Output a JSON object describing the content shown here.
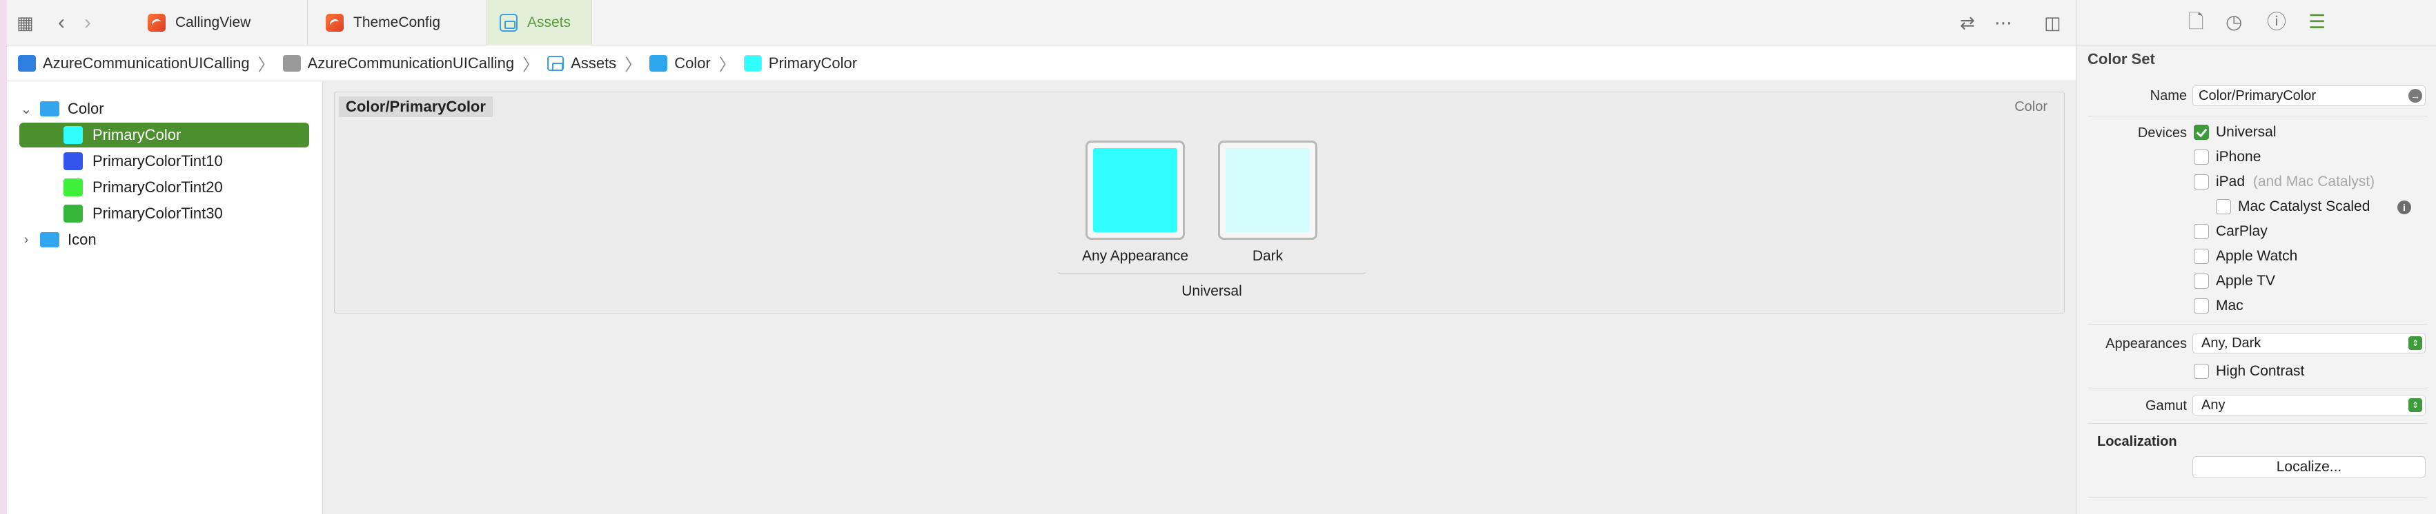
{
  "tabs": [
    {
      "label": "CallingView",
      "icon": "swift-file-icon"
    },
    {
      "label": "ThemeConfig",
      "icon": "swift-file-icon"
    },
    {
      "label": "Assets",
      "icon": "asset-catalog-icon",
      "active": true
    }
  ],
  "breadcrumb": [
    "AzureCommunicationUICalling",
    "AzureCommunicationUICalling",
    "Assets",
    "Color",
    "PrimaryColor"
  ],
  "navigator": {
    "folders": [
      {
        "label": "Color",
        "expanded": true
      },
      {
        "label": "Icon",
        "expanded": false
      }
    ],
    "items": [
      {
        "label": "PrimaryColor",
        "color": "#2fffff",
        "selected": true
      },
      {
        "label": "PrimaryColorTint10",
        "color": "#3355ee"
      },
      {
        "label": "PrimaryColorTint20",
        "color": "#3ef03a"
      },
      {
        "label": "PrimaryColorTint30",
        "color": "#36b53a"
      }
    ]
  },
  "colorset": {
    "title": "Color/PrimaryColor",
    "type": "Color",
    "wells": [
      {
        "label": "Any Appearance",
        "color": "#2fffff"
      },
      {
        "label": "Dark",
        "color": "#d3fcfc"
      }
    ],
    "group_label": "Universal"
  },
  "inspector": {
    "section_title": "Color Set",
    "name_label": "Name",
    "name_value": "Color/PrimaryColor",
    "devices_label": "Devices",
    "devices": [
      {
        "label": "Universal",
        "checked": true
      },
      {
        "label": "iPhone",
        "checked": false
      },
      {
        "label": "iPad",
        "suffix": "(and Mac Catalyst)",
        "checked": false
      },
      {
        "label": "Mac Catalyst Scaled",
        "checked": false
      },
      {
        "label": "CarPlay",
        "checked": false
      },
      {
        "label": "Apple Watch",
        "checked": false
      },
      {
        "label": "Apple TV",
        "checked": false
      },
      {
        "label": "Mac",
        "checked": false
      }
    ],
    "appearances_label": "Appearances",
    "appearances_value": "Any, Dark",
    "high_contrast_label": "High Contrast",
    "gamut_label": "Gamut",
    "gamut_value": "Any",
    "localization_title": "Localization",
    "localize_button": "Localize..."
  },
  "colors": {
    "accent": "#4b8f2e",
    "link": "#5a9a3b"
  }
}
